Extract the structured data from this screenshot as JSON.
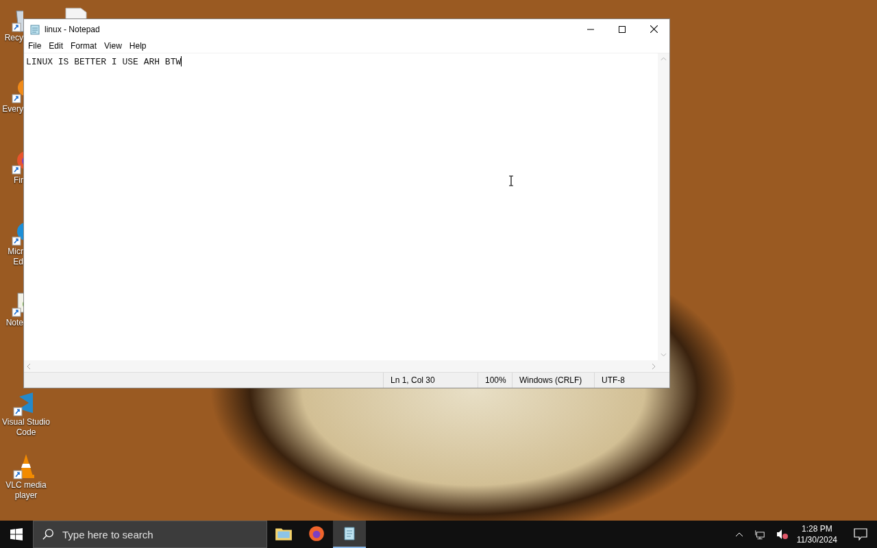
{
  "desktop": {
    "icons": [
      {
        "kind": "recycle-bin",
        "label": "Recy",
        "clipped": true
      },
      {
        "kind": "orange-app",
        "label": "Every",
        "clipped": true
      },
      {
        "kind": "firefox",
        "label": "Fir",
        "clipped": true
      },
      {
        "kind": "edge",
        "label": "Micr\nEd",
        "clipped": true
      },
      {
        "kind": "notepad-plus",
        "label": "Note",
        "clipped": true
      },
      {
        "kind": "vscode",
        "label": "Visual Studio\nCode",
        "clipped": false
      },
      {
        "kind": "vlc",
        "label": "VLC media\nplayer",
        "clipped": false
      }
    ]
  },
  "window": {
    "title": "linux - Notepad",
    "menu": [
      "File",
      "Edit",
      "Format",
      "View",
      "Help"
    ],
    "text": "LINUX IS BETTER I USE ARH BTW",
    "status": [
      "Ln 1, Col 30",
      "100%",
      "Windows (CRLF)",
      "UTF-8"
    ]
  },
  "taskbar": {
    "search_placeholder": "Type here to search",
    "apps": [
      {
        "kind": "explorer",
        "active": false
      },
      {
        "kind": "firefox",
        "active": false
      },
      {
        "kind": "notepad",
        "active": true
      }
    ],
    "time": "1:28 PM",
    "date": "11/30/2024"
  }
}
